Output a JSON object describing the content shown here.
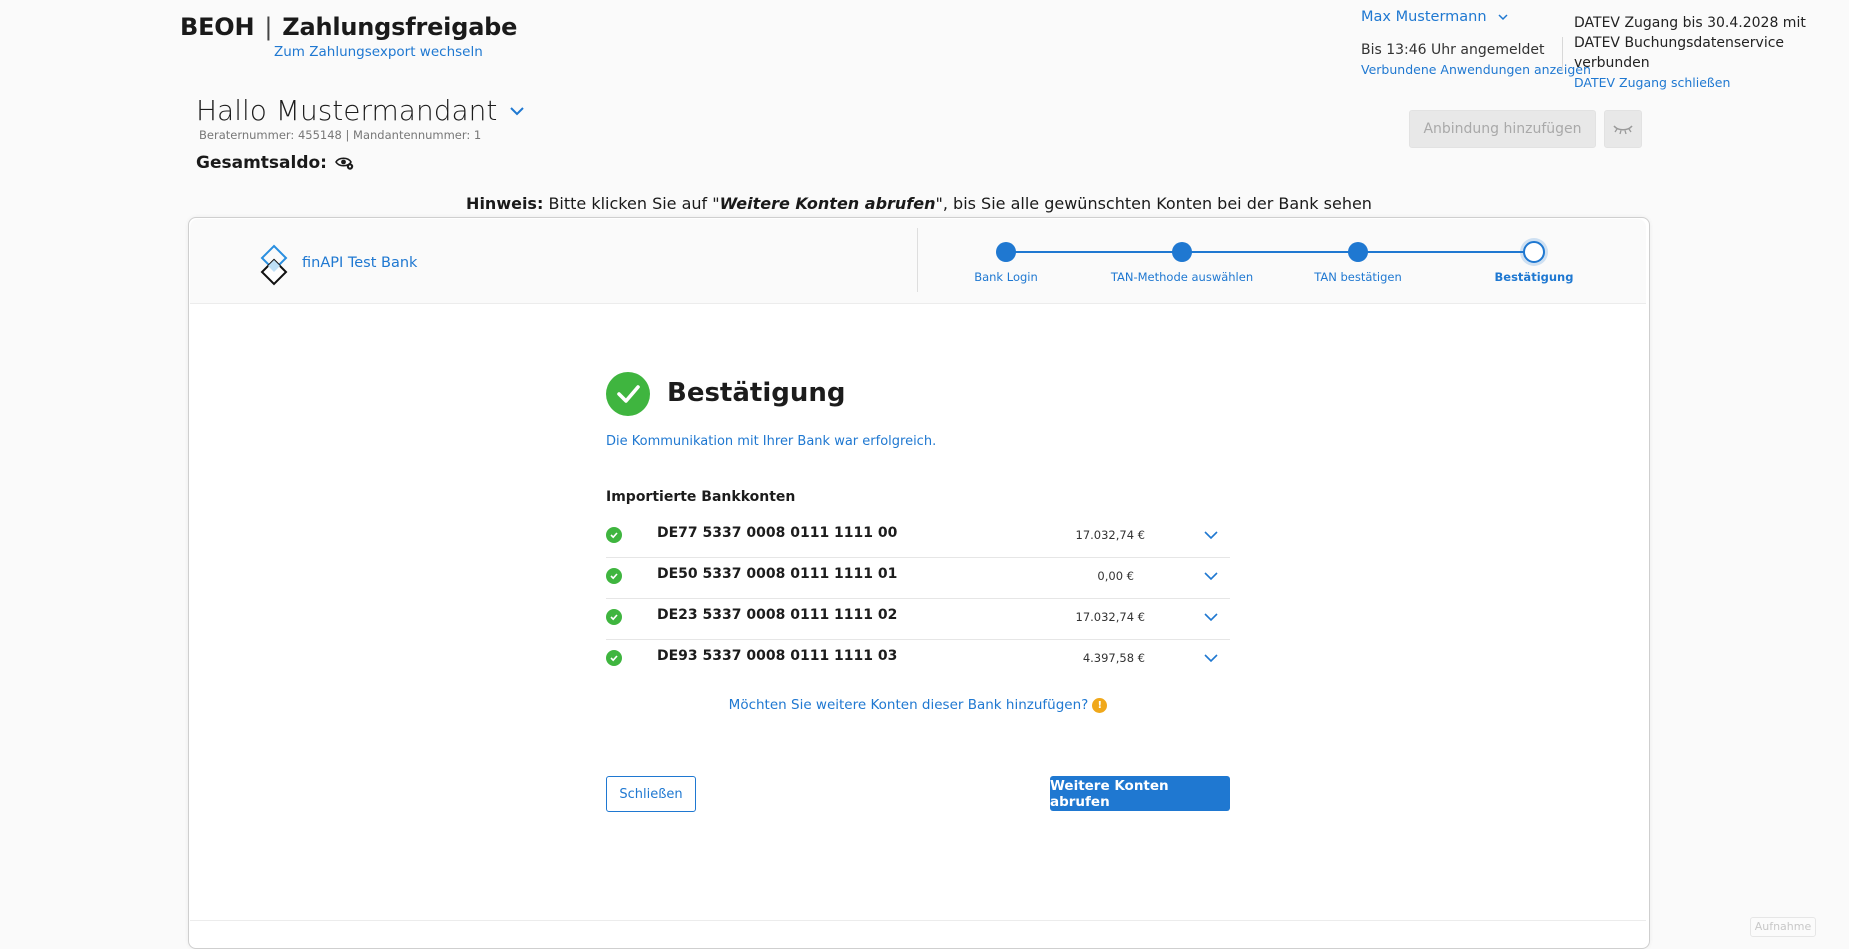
{
  "header": {
    "brand": "BEOH",
    "separator": "|",
    "app_title": "Zahlungsfreigabe",
    "switch_link": "Zum Zahlungsexport wechseln"
  },
  "user": {
    "name": "Max Mustermann",
    "login_status": "Bis 13:46 Uhr angemeldet",
    "connected_apps_link": "Verbundene Anwendungen anzeigen"
  },
  "datev": {
    "info": "DATEV Zugang bis 30.4.2028 mit DATEV Buchungsdatenservice verbunden",
    "close_link": "DATEV Zugang schließen"
  },
  "client": {
    "greeting": "Hallo Mustermandant",
    "berater": "Beraternummer: 455148 | Mandantennummer: 1",
    "balance_label": "Gesamtsaldo:"
  },
  "actions": {
    "add_connection": "Anbindung hinzufügen"
  },
  "hint": {
    "label": "Hinweis:",
    "text_before": " Bitte klicken Sie auf \"",
    "emphasis": "Weitere Konten abrufen",
    "text_after": "\", bis Sie alle gewünschten Konten bei der Bank sehen"
  },
  "bank": {
    "name": "finAPI Test Bank"
  },
  "steps": [
    {
      "label": "Bank Login",
      "state": "done"
    },
    {
      "label": "TAN-Methode auswählen",
      "state": "done"
    },
    {
      "label": "TAN bestätigen",
      "state": "done"
    },
    {
      "label": "Bestätigung",
      "state": "current"
    }
  ],
  "confirmation": {
    "title": "Bestätigung",
    "subtitle": "Die Kommunikation mit Ihrer Bank war erfolgreich.",
    "imported_title": "Importierte Bankkonten"
  },
  "accounts": [
    {
      "iban": "DE77 5337 0008 0111 1111 00",
      "amount": "17.032,74 €"
    },
    {
      "iban": "DE50 5337 0008 0111 1111 01",
      "amount": "0,00 €"
    },
    {
      "iban": "DE23 5337 0008 0111 1111 02",
      "amount": "17.032,74 €"
    },
    {
      "iban": "DE93 5337 0008 0111 1111 03",
      "amount": "4.397,58 €"
    }
  ],
  "more_accounts": {
    "question": "Möchten Sie weitere Konten dieser Bank hinzufügen?",
    "info_symbol": "!"
  },
  "buttons": {
    "close": "Schließen",
    "fetch_more": "Weitere Konten abrufen"
  },
  "footer": {
    "ghost_label": "Aufnahme"
  },
  "colors": {
    "accent": "#1f78d1",
    "success": "#3fb53f",
    "warning": "#f0a81b",
    "disabled_bg": "#e8e8e8"
  }
}
